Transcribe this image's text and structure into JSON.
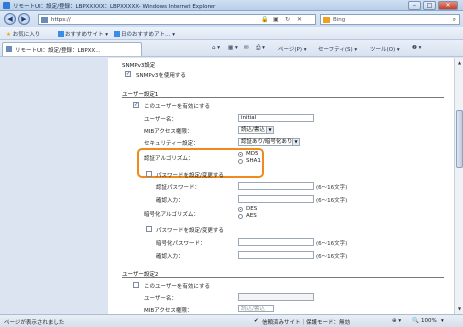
{
  "window": {
    "title": "リモートUI：設定/登録：LBPXXXXX：LBPXXXXX- Windows Internet Explorer",
    "controls": [
      "–",
      "□",
      "✕"
    ]
  },
  "addressbar": {
    "url": "https://",
    "search_placeholder": "Bing",
    "icons": [
      "back-icon",
      "forward-icon",
      "lock-icon",
      "certificate-icon",
      "refresh-icon",
      "stop-icon",
      "search-icon"
    ]
  },
  "favorites": {
    "label": "お気に入り",
    "items": [
      "おすすめサイト ▾",
      "日のおすすめアト… ▾"
    ]
  },
  "tab": {
    "label": "リモートUI：設定/登録：LBPXX..."
  },
  "commandbar": {
    "items": [
      "ページ(P) ▾",
      "セーフティ(S) ▾",
      "ツール(O) ▾",
      "❷ ▾"
    ]
  },
  "form": {
    "snmp_section": "SNMPv3設定",
    "snmp_use": "SNMPv3を使用する",
    "user1_title": "ユーザー設定1",
    "user1_enable": "このユーザーを有効にする",
    "username_label": "ユーザー名：",
    "username_value": "initial",
    "mib_label": "MIBアクセス権限：",
    "mib_value": "読込/書込",
    "security_label": "セキュリティー設定：",
    "security_value": "認証あり/暗号化あり",
    "auth_algo_label": "認証アルゴリズム：",
    "auth_options": [
      "MD5",
      "SHA1"
    ],
    "auth_pw_change": "パスワードを設定/変更する",
    "auth_pw_label": "認証パスワード：",
    "confirm_label": "確認入力：",
    "length_hint": "(6〜16文字)",
    "enc_algo_label": "暗号化アルゴリズム：",
    "enc_options": [
      "DES",
      "AES"
    ],
    "enc_pw_change": "パスワードを設定/変更する",
    "enc_pw_label": "暗号化パスワード：",
    "user2_title": "ユーザー設定2",
    "user2_enable": "このユーザーを有効にする",
    "user2_mib_value": "読込/書込"
  },
  "statusbar": {
    "left": "ページが表示されました",
    "zone": "信頼済みサイト｜保護モード：無効",
    "zoom": "100%"
  }
}
